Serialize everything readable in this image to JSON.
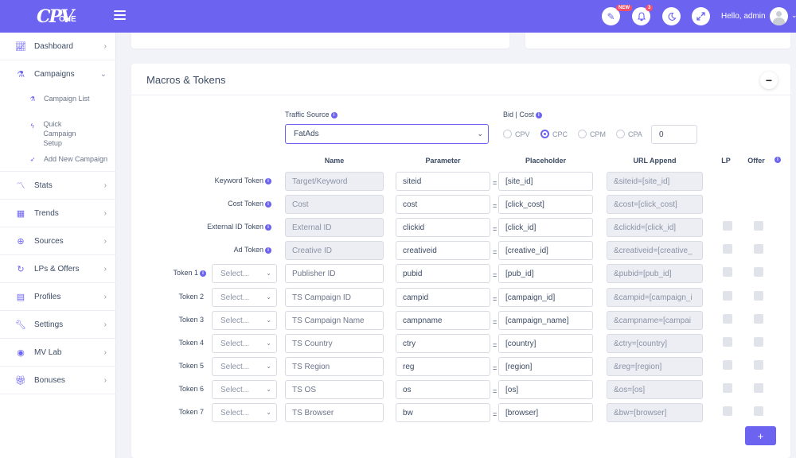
{
  "app": {
    "logo_mark": "CPV",
    "logo_sub": "ONE",
    "greeting": "Hello, admin",
    "new_badge": "NEW",
    "notif_count": "3",
    "accent": "#6c63f0"
  },
  "sidebar": {
    "items": [
      {
        "label": "Dashboard",
        "icon": "chart-line-icon"
      },
      {
        "label": "Campaigns",
        "icon": "flask-icon"
      },
      {
        "label": "Stats",
        "icon": "chart-area-icon"
      },
      {
        "label": "Trends",
        "icon": "trends-icon"
      },
      {
        "label": "Sources",
        "icon": "globe-icon"
      },
      {
        "label": "LPs & Offers",
        "icon": "lp-offers-icon"
      },
      {
        "label": "Profiles",
        "icon": "profiles-icon"
      },
      {
        "label": "Settings",
        "icon": "wrench-icon"
      },
      {
        "label": "MV Lab",
        "icon": "mv-lab-icon"
      },
      {
        "label": "Bonuses",
        "icon": "gift-icon"
      }
    ],
    "sub_items": [
      {
        "label": "Campaign List"
      },
      {
        "label": "Quick Campaign Setup"
      },
      {
        "label": "Add New Campaign"
      }
    ]
  },
  "macros": {
    "title": "Macros & Tokens",
    "collapse_label": "−",
    "traffic_source_label": "Traffic Source",
    "traffic_source_value": "FatAds",
    "bid_cost_label": "Bid | Cost",
    "bid_options": [
      "CPV",
      "CPC",
      "CPM",
      "CPA"
    ],
    "bid_selected": "CPC",
    "bid_value": "0",
    "columns": {
      "name": "Name",
      "parameter": "Parameter",
      "placeholder": "Placeholder",
      "url_append": "URL Append",
      "lp": "LP",
      "offer": "Offer"
    },
    "equals": "=",
    "select_placeholder": "Select...",
    "add_label": "+",
    "rows": [
      {
        "label": "Keyword Token",
        "info": true,
        "select": false,
        "name": "Target/Keyword",
        "name_ro": true,
        "parameter": "siteid",
        "placeholder": "[site_id]",
        "append": "&siteid=[site_id]",
        "checks": false
      },
      {
        "label": "Cost Token",
        "info": true,
        "select": false,
        "name": "Cost",
        "name_ro": true,
        "parameter": "cost",
        "placeholder": "[click_cost]",
        "append": "&cost=[click_cost]",
        "checks": false
      },
      {
        "label": "External ID Token",
        "info": true,
        "select": false,
        "name": "External ID",
        "name_ro": true,
        "parameter": "clickid",
        "placeholder": "[click_id]",
        "append": "&clickid=[click_id]",
        "checks": true
      },
      {
        "label": "Ad Token",
        "info": true,
        "select": false,
        "name": "Creative ID",
        "name_ro": true,
        "parameter": "creativeid",
        "placeholder": "[creative_id]",
        "append": "&creativeid=[creative_",
        "checks": true
      },
      {
        "label": "Token 1",
        "info": true,
        "select": true,
        "name": "Publisher ID",
        "name_ro": false,
        "parameter": "pubid",
        "placeholder": "[pub_id]",
        "append": "&pubid=[pub_id]",
        "checks": true
      },
      {
        "label": "Token 2",
        "info": false,
        "select": true,
        "name": "TS Campaign ID",
        "name_ro": false,
        "parameter": "campid",
        "placeholder": "[campaign_id]",
        "append": "&campid=[campaign_i",
        "checks": true
      },
      {
        "label": "Token 3",
        "info": false,
        "select": true,
        "name": "TS Campaign Name",
        "name_ro": false,
        "parameter": "campname",
        "placeholder": "[campaign_name]",
        "append": "&campname=[campai",
        "checks": true
      },
      {
        "label": "Token 4",
        "info": false,
        "select": true,
        "name": "TS Country",
        "name_ro": false,
        "parameter": "ctry",
        "placeholder": "[country]",
        "append": "&ctry=[country]",
        "checks": true
      },
      {
        "label": "Token 5",
        "info": false,
        "select": true,
        "name": "TS Region",
        "name_ro": false,
        "parameter": "reg",
        "placeholder": "[region]",
        "append": "&reg=[region]",
        "checks": true
      },
      {
        "label": "Token 6",
        "info": false,
        "select": true,
        "name": "TS OS",
        "name_ro": false,
        "parameter": "os",
        "placeholder": "[os]",
        "append": "&os=[os]",
        "checks": true
      },
      {
        "label": "Token 7",
        "info": false,
        "select": true,
        "name": "TS Browser",
        "name_ro": false,
        "parameter": "bw",
        "placeholder": "[browser]",
        "append": "&bw=[browser]",
        "checks": true
      }
    ]
  }
}
